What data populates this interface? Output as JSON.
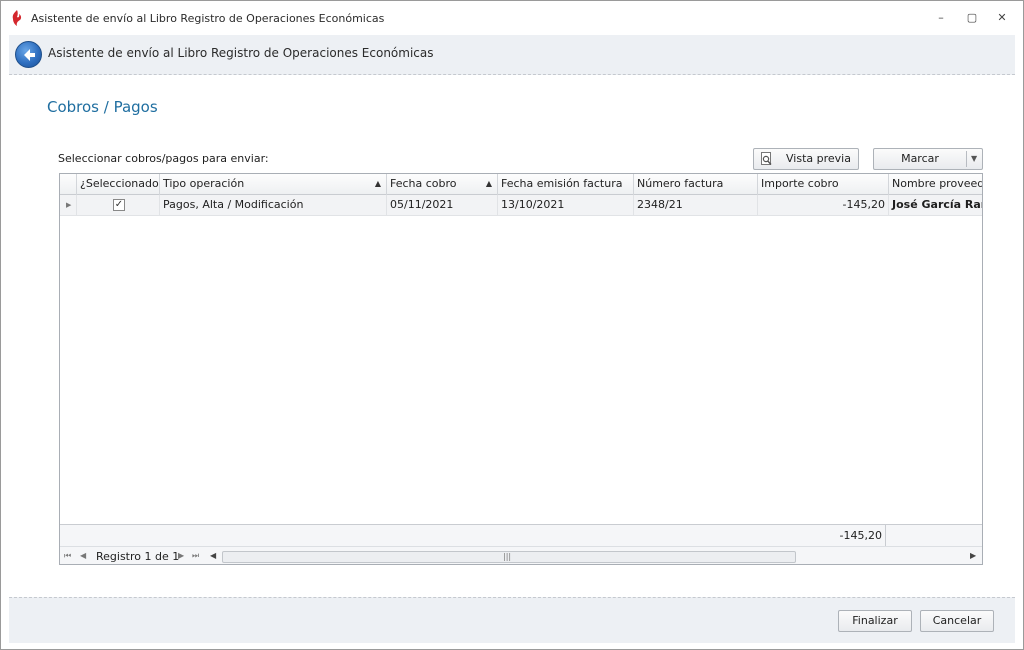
{
  "window": {
    "title": "Asistente de envío al Libro Registro de Operaciones Económicas",
    "controls": {
      "minimize": "–",
      "restore": "▢",
      "close": "✕"
    }
  },
  "wizard": {
    "header_title": "Asistente de envío al Libro Registro de Operaciones Económicas",
    "back_icon": "back-arrow-icon"
  },
  "page": {
    "title": "Cobros / Pagos",
    "select_label": "Seleccionar cobros/pagos para enviar:"
  },
  "toolbar": {
    "preview_label": "Vista previa",
    "mark_label": "Marcar"
  },
  "grid": {
    "columns": [
      "¿Seleccionado?",
      "Tipo operación",
      "Fecha cobro",
      "Fecha emisión factura",
      "Número factura",
      "Importe cobro",
      "Nombre proveedor"
    ],
    "rows": [
      {
        "selected": true,
        "tipo": "Pagos, Alta / Modificación",
        "fecha_cobro": "05/11/2021",
        "fecha_emision": "13/10/2021",
        "numero": "2348/21",
        "importe": "-145,20",
        "proveedor": "José García Ramos"
      }
    ],
    "footer_total": "-145,20",
    "navigator": "Registro 1 de 1"
  },
  "actions": {
    "finish_label": "Finalizar",
    "cancel_label": "Cancelar"
  },
  "colors": {
    "accent": "#1f6ea0",
    "header_bg": "#edf0f4",
    "back_button": "#2f6fc0"
  }
}
